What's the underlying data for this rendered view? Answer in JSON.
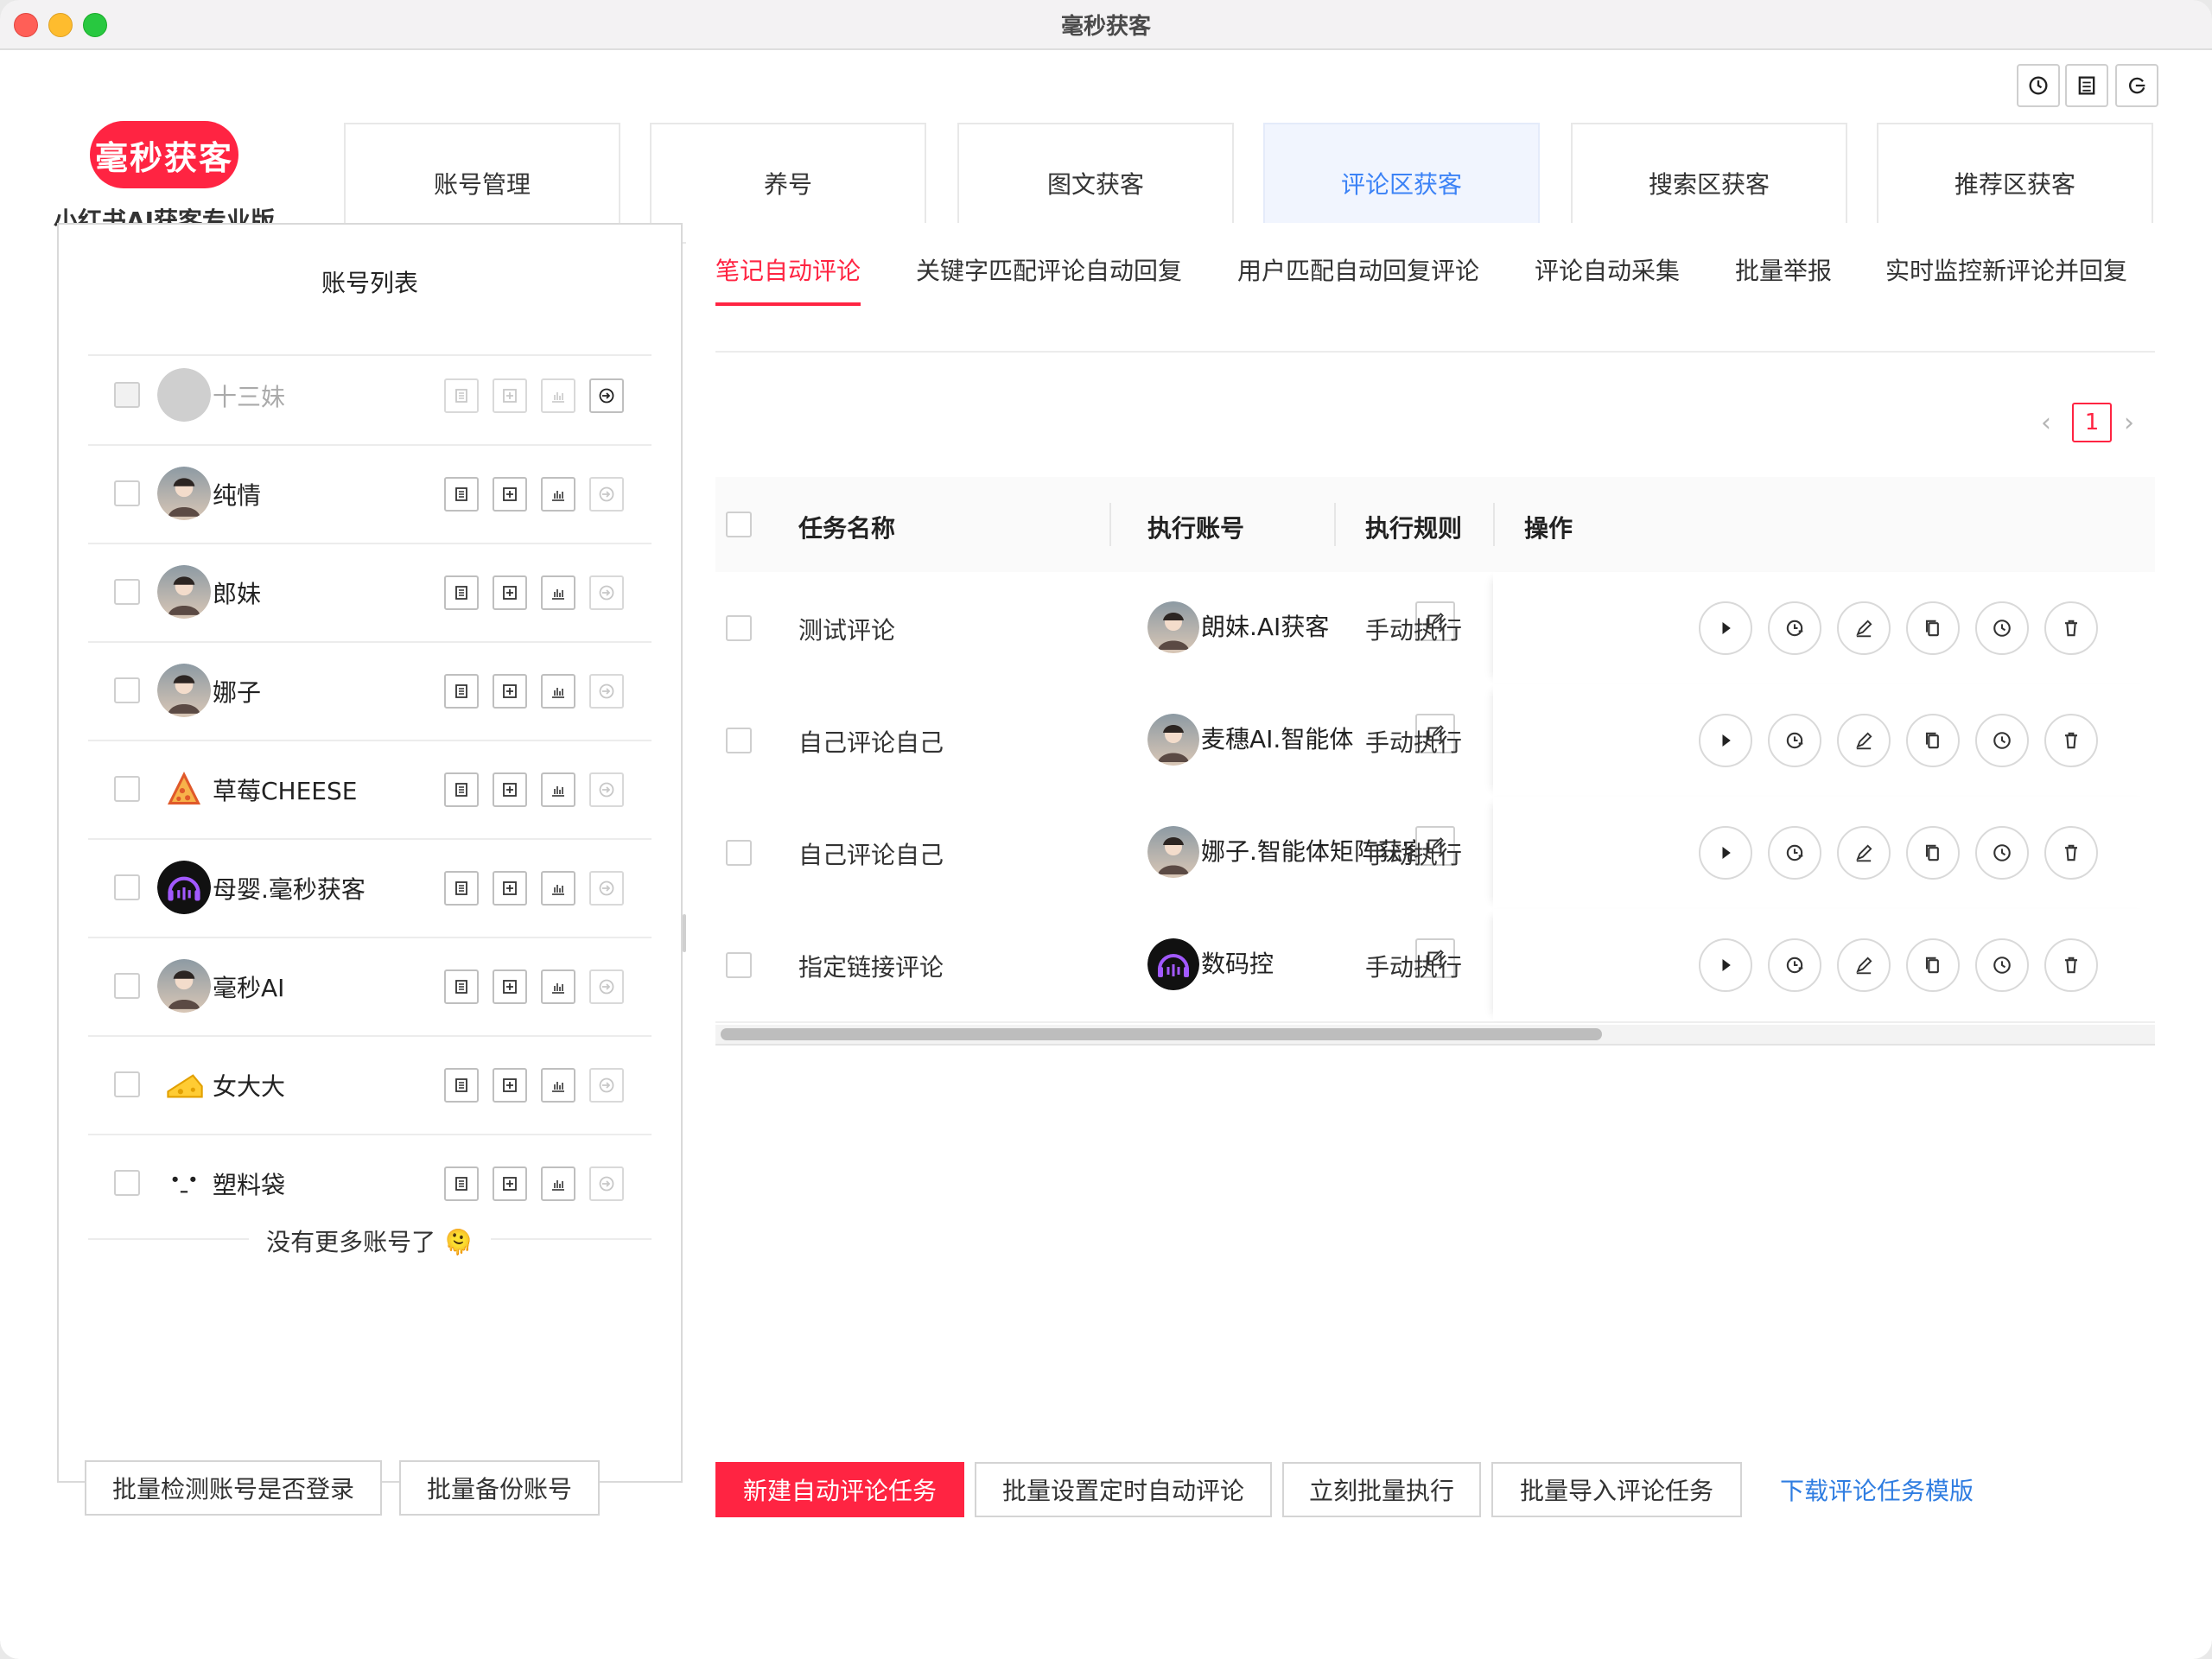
{
  "window": {
    "title": "毫秒获客"
  },
  "logo": {
    "badge": "毫秒获客",
    "subtitle": "小红书AI获客专业版"
  },
  "nav": [
    {
      "label": "账号管理",
      "active": false
    },
    {
      "label": "养号",
      "active": false
    },
    {
      "label": "图文获客",
      "active": false
    },
    {
      "label": "评论区获客",
      "active": true
    },
    {
      "label": "搜索区获客",
      "active": false
    },
    {
      "label": "推荐区获客",
      "active": false
    }
  ],
  "account_panel": {
    "title": "账号列表",
    "accounts": [
      {
        "name": "十三妹",
        "avatar": "gray-avatar",
        "disabled": true
      },
      {
        "name": "纯情",
        "avatar": "photo-avatar",
        "disabled": false
      },
      {
        "name": "郎妹",
        "avatar": "photo-avatar",
        "disabled": false
      },
      {
        "name": "娜子",
        "avatar": "photo-avatar",
        "disabled": false
      },
      {
        "name": "草莓CHEESE",
        "avatar": "pizza-avatar",
        "disabled": false
      },
      {
        "name": "母婴.毫秒获客",
        "avatar": "headphone-avatar",
        "disabled": false
      },
      {
        "name": "毫秒AI",
        "avatar": "photo-avatar",
        "disabled": false
      },
      {
        "name": "女大大",
        "avatar": "cheese-avatar",
        "disabled": false
      },
      {
        "name": "塑料袋",
        "avatar": "face-avatar",
        "disabled": false
      }
    ],
    "no_more": "没有更多账号了 🫠",
    "buttons": {
      "check_login": "批量检测账号是否登录",
      "backup": "批量备份账号"
    }
  },
  "tabs": [
    {
      "label": "笔记自动评论",
      "active": true
    },
    {
      "label": "关键字匹配评论自动回复",
      "active": false
    },
    {
      "label": "用户匹配自动回复评论",
      "active": false
    },
    {
      "label": "评论自动采集",
      "active": false
    },
    {
      "label": "批量举报",
      "active": false
    },
    {
      "label": "实时监控新评论并回复",
      "active": false
    }
  ],
  "pagination": {
    "current": "1",
    "prev": "‹",
    "next": "›"
  },
  "table": {
    "headers": {
      "name": "任务名称",
      "account": "执行账号",
      "rule": "执行规则",
      "ops": "操作"
    },
    "rows": [
      {
        "name": "测试评论",
        "account": "朗妹.AI获客",
        "avatar": "photo-avatar",
        "rule": "手动执行"
      },
      {
        "name": "自己评论自己",
        "account": "麦穗AI.智能体",
        "avatar": "photo-avatar",
        "rule": "手动执行"
      },
      {
        "name": "自己评论自己",
        "account": "娜子.智能体矩阵获客",
        "avatar": "photo-avatar",
        "rule": "手动执行"
      },
      {
        "name": "指定链接评论",
        "account": "数码控",
        "avatar": "headphone-avatar",
        "rule": "手动执行"
      }
    ]
  },
  "actions": {
    "new_task": "新建自动评论任务",
    "batch_schedule": "批量设置定时自动评论",
    "run_now": "立刻批量执行",
    "import": "批量导入评论任务",
    "download_template": "下载评论任务模版"
  },
  "colors": {
    "brand": "#ff2442",
    "accent": "#3b82f6",
    "link": "#2f7de1"
  }
}
